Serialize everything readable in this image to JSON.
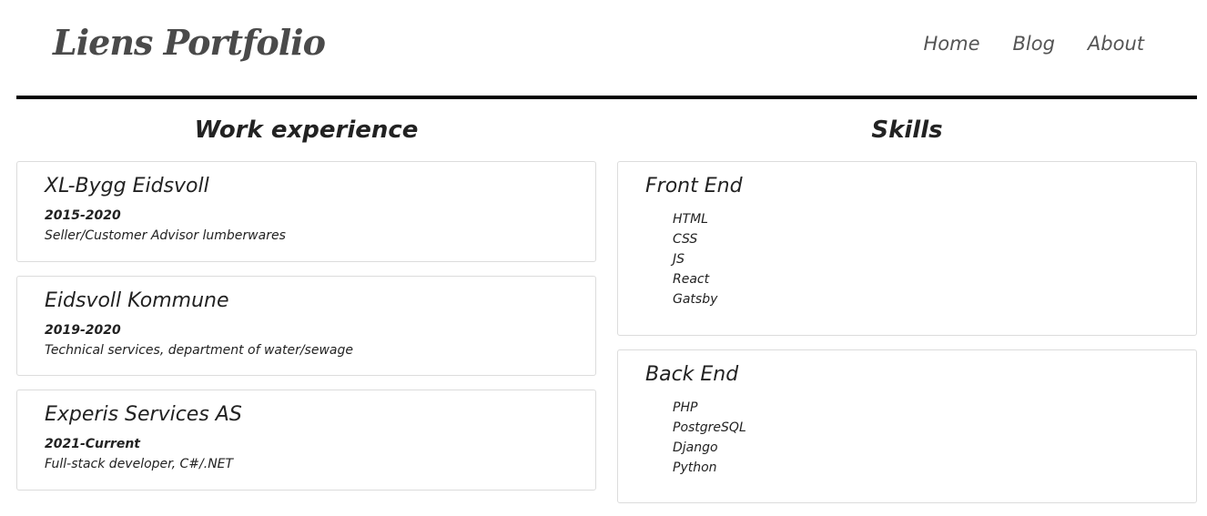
{
  "header": {
    "logo": "Liens Portfolio",
    "nav": [
      "Home",
      "Blog",
      "About"
    ]
  },
  "work": {
    "title": "Work experience",
    "items": [
      {
        "company": "XL-Bygg Eidsvoll",
        "years": "2015-2020",
        "role": "Seller/Customer Advisor lumberwares"
      },
      {
        "company": "Eidsvoll Kommune",
        "years": "2019-2020",
        "role": "Technical services, department of water/sewage"
      },
      {
        "company": "Experis Services AS",
        "years": "2021-Current",
        "role": "Full-stack developer, C#/.NET"
      }
    ]
  },
  "skills": {
    "title": "Skills",
    "groups": [
      {
        "name": "Front End",
        "items": [
          "HTML",
          "CSS",
          "JS",
          "React",
          "Gatsby"
        ]
      },
      {
        "name": "Back End",
        "items": [
          "PHP",
          "PostgreSQL",
          "Django",
          "Python"
        ]
      }
    ]
  }
}
